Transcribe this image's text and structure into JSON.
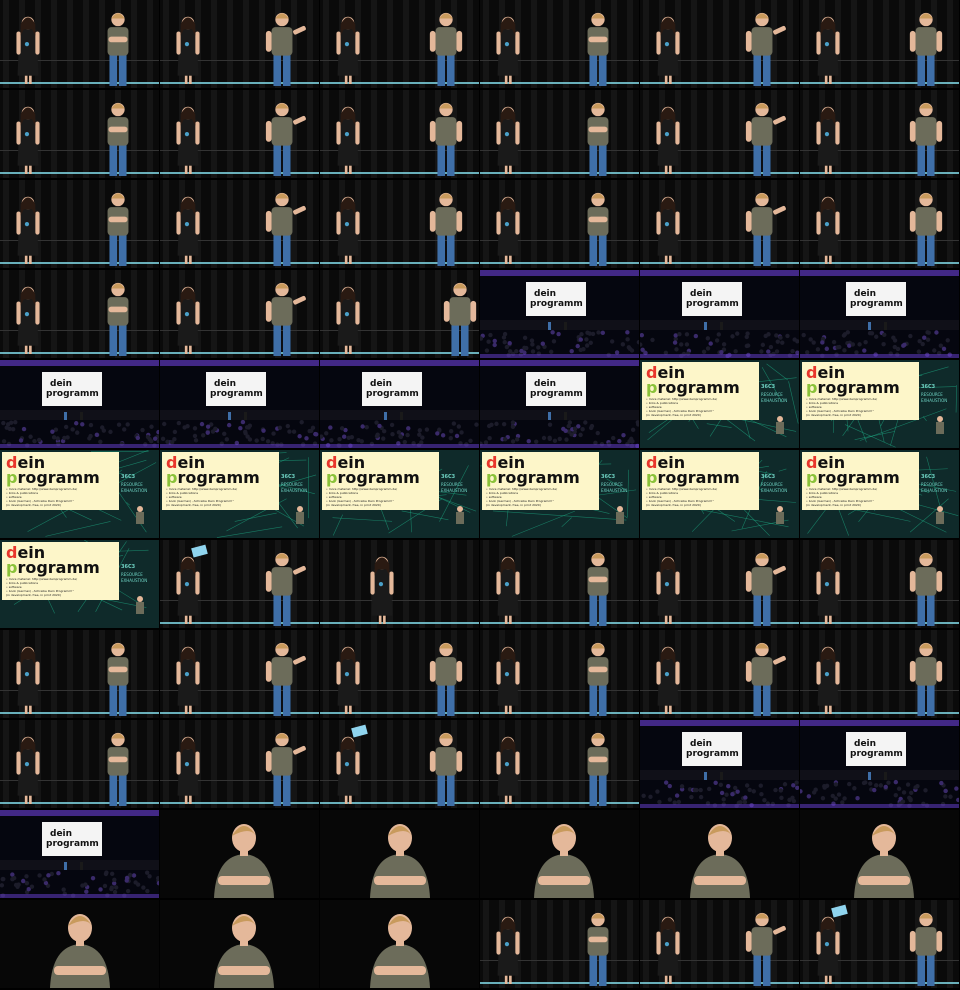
{
  "sheet": {
    "columns": 6,
    "rows": 11,
    "frames": [
      "stage",
      "stage",
      "stage",
      "stage",
      "stage",
      "stage",
      "stage",
      "stage",
      "stage",
      "stage",
      "stage",
      "stage",
      "stage",
      "stage",
      "stage",
      "stage",
      "stage",
      "stage",
      "stage",
      "stage",
      "stage-mic",
      "wide",
      "wide",
      "wide",
      "wide",
      "wide",
      "wide",
      "wide",
      "slide",
      "slide",
      "slide",
      "slide",
      "slide",
      "slide",
      "slide",
      "slide",
      "slide",
      "stage-sign",
      "stage-woman",
      "stage",
      "stage",
      "stage",
      "stage",
      "stage",
      "stage",
      "stage",
      "stage",
      "stage",
      "stage",
      "stage",
      "stage-sign",
      "stage",
      "wide",
      "wide",
      "wide",
      "closeup",
      "closeup",
      "closeup",
      "closeup",
      "closeup",
      "closeup",
      "closeup",
      "closeup",
      "stage",
      "stage",
      "stage-sign"
    ]
  },
  "slide": {
    "logo_line1": "dein",
    "logo_line2": "programm",
    "bullets": [
      "more material: http://www.deinprogramm.de/",
      "links & publications",
      "software",
      "book (German) „Schreibe Dein Programm!“",
      "(in development, free, in print 2020)"
    ],
    "conference_line1": "36C3",
    "conference_line2": "RESOURCE",
    "conference_line3": "EXHAUSTION",
    "colors": {
      "slide_bg": "#fdf6c9",
      "network_bg": "#0f2a2a",
      "network_line": "#1fb38a",
      "letter_d": "#e8362c",
      "letter_p": "#8ac23a"
    }
  },
  "stage": {
    "colors": {
      "curtain": "#151515",
      "floor_light": "#7fd8e6",
      "shirt": "#6c6c5a",
      "jeans": "#3f6fa8",
      "skin": "#e4b89a",
      "hair_blond": "#c89a5c",
      "woman_dress": "#1a1a1a",
      "woman_hair": "#2a1a12",
      "audience_light": "#6a3fd6",
      "screen_white": "#f4f4f4"
    }
  }
}
